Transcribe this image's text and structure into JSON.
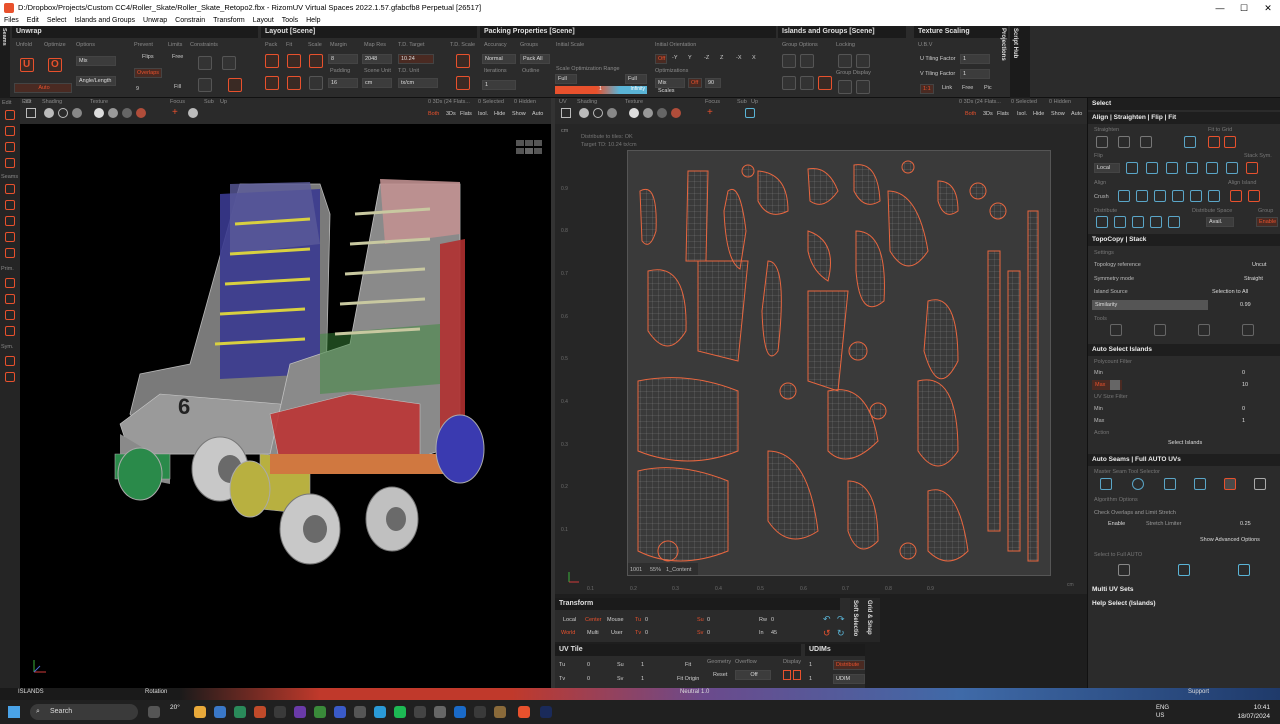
{
  "window": {
    "title": "D:/Dropbox/Projects/Custom CC4/Roller_Skate/Roller_Skate_Retopo2.fbx - RizomUV  Virtual Spaces 2022.1.57.gfabcfb8 Perpetual  [26517]",
    "minimize": "—",
    "maximize": "☐",
    "close": "✕"
  },
  "menu": [
    "Files",
    "Edit",
    "Select",
    "Islands and Groups",
    "Unwrap",
    "Constrain",
    "Transform",
    "Layout",
    "Tools",
    "Help"
  ],
  "ribbon": {
    "seams_tab": "Seams",
    "unwrap": {
      "title": "Unwrap",
      "labels": [
        "Unfold",
        "Optimize",
        "Options",
        "Prevent",
        "Limits",
        "Constraints"
      ],
      "auto": "Auto",
      "mix": "Mix",
      "angle_length": "Angle/Length",
      "flips": "Flips",
      "overlaps": "Overlaps",
      "free": "Free",
      "fill": "Fill",
      "value_9": "9"
    },
    "layout": {
      "title": "Layout [Scene]",
      "labels": [
        "Pack",
        "Fit",
        "Scale",
        "Margin",
        "Map Res",
        "T.D. Target",
        "T.D. Scale",
        "Padding",
        "Scene Unit",
        "T.D. Unit"
      ],
      "margin": "8",
      "map_res": "2048",
      "td_target": "10.24",
      "padding": "16",
      "scene_unit": "cm",
      "td_unit": "tx/cm"
    },
    "packing": {
      "title": "Packing Properties [Scene]",
      "labels": [
        "Accuracy",
        "Groups",
        "Initial Scale",
        "Initial Orientation",
        "Iterations",
        "Outline",
        "Scale Optimization Range",
        "Optimizations"
      ],
      "accuracy": "Normal",
      "pack_all": "Pack All",
      "iterations": "1",
      "full1": "Full",
      "full2": "Full",
      "mix_scales": "Mix Scales",
      "off1": "Off",
      "off2": "Off",
      "value_90": "90",
      "infinity": "Infinity",
      "one": "1",
      "axes": [
        "-Y",
        "Y",
        "-Z",
        "Z",
        "-X",
        "X"
      ]
    },
    "islands": {
      "title": "Islands and Groups [Scene]",
      "labels": [
        "Group Options",
        "Locking",
        "Group Display"
      ]
    },
    "texture": {
      "title": "Texture Scaling",
      "uvs": "U.B.V",
      "u_tiling": "U Tiling Factor",
      "u_val": "1",
      "v_tiling": "V Tiling Factor",
      "v_val": "1",
      "ratio": "1:1",
      "link": "Link",
      "free": "Free",
      "pic": "Pic"
    },
    "script_hub": "Script Hub",
    "projections": "Projections"
  },
  "vp3d": {
    "labels": [
      "Edit",
      "3D",
      "Shading",
      "Texture",
      "Focus",
      "Sub",
      "Up"
    ],
    "counts": "0 3Ds (24 Flats...",
    "selected": "0 Selected",
    "hidden": "0 Hidden",
    "modes": [
      "Both",
      "3Ds",
      "Flats",
      "Isol.",
      "Hide",
      "Show",
      "Auto"
    ],
    "left_labels": [
      "Edit",
      "Seams",
      "Prim.",
      "Sym."
    ]
  },
  "uv": {
    "labels": [
      "UV",
      "Shading",
      "Texture",
      "Focus",
      "Sub",
      "Up"
    ],
    "counts": "0 3Ds (24 Flats...",
    "selected": "0 Selected",
    "hidden": "0 Hidden",
    "modes": [
      "Both",
      "3Ds",
      "Flats",
      "Isol.",
      "Hide",
      "Show",
      "Auto"
    ],
    "info_line1": "Distribute to tiles: OK",
    "info_line2": "Target TD: 10.24 tx/cm",
    "udim_tile": "1001",
    "udim_pct": "55%",
    "udim_name": "1_Content",
    "ticks_x": [
      "0.1",
      "0.2",
      "0.3",
      "0.4",
      "0.5",
      "0.6",
      "0.7",
      "0.8",
      "0.9"
    ],
    "ticks_y": [
      "0.9",
      "0.8",
      "0.7",
      "0.6",
      "0.5",
      "0.4",
      "0.3",
      "0.2",
      "0.1"
    ],
    "unit_corner": "cm",
    "unit_y": "cm"
  },
  "transform": {
    "title": "Transform",
    "local": "Local",
    "center": "Center",
    "mouse": "Mouse",
    "world": "World",
    "multi": "Multi",
    "user": "User",
    "tu": "Tu",
    "tu_val": "0",
    "tv": "Tv",
    "tv_val": "0",
    "su": "Su",
    "su_val": "0",
    "sv": "Sv",
    "sv_val": "0",
    "rw": "Rw",
    "rw_val": "0",
    "in": "In",
    "in_val": "45"
  },
  "uvtile": {
    "title": "UV Tile",
    "tu": "Tu",
    "tu_val": "0",
    "su": "Su",
    "su_val": "1",
    "tv": "Tv",
    "tv_val": "0",
    "sv": "Sv",
    "sv_val": "1",
    "fit": "Fit",
    "fit_origin": "Fit Origin",
    "geometry": "Geometry",
    "overflow": "Overflow",
    "reset": "Reset",
    "off": "Off",
    "display": "Display"
  },
  "udims": {
    "title": "UDIMs",
    "distribute": "Distribute",
    "val": "1",
    "udim": "UDIM"
  },
  "sidepanels": {
    "grid_snap": "Grid & Snap",
    "soft_selection": "Soft Selectio"
  },
  "right": {
    "select": "Select",
    "align": "Align | Straighten | Flip | Fit",
    "align_labels": [
      "Straighten",
      "Fit to Grid",
      "Flip",
      "Stack Sym.",
      "Local",
      "Align",
      "Align Island",
      "Crush",
      "Distribute",
      "Distribute Space",
      "Avail.",
      "Group",
      "Enable"
    ],
    "topo": {
      "title": "TopoCopy | Stack",
      "settings": "Settings",
      "topology_reference": "Topology reference",
      "topology_val": "Uncut",
      "symmetry_mode": "Symmetry mode",
      "symmetry_val": "Straight",
      "island_source": "Island Source",
      "island_val": "Selection to All",
      "similarity": "Similarity",
      "similarity_val": "0.99",
      "tools": "Tools"
    },
    "auto_select": {
      "title": "Auto Select Islands",
      "polycount": "Polycount Filter",
      "min": "Min",
      "min_val": "0",
      "max": "Max",
      "max_val": "10",
      "uv_size": "UV Size Filter",
      "min2": "Min",
      "min2_val": "0",
      "max2": "Max",
      "max2_val": "1",
      "action": "Action",
      "select_islands": "Select Islands"
    },
    "auto_seams": {
      "title": "Auto Seams | Full AUTO UVs",
      "master": "Master Seam Tool Selector",
      "algo": "Algorithm Options",
      "check": "Check Overlaps and Limit Stretch",
      "enable": "Enable",
      "stretch_limiter": "Stretch Limiter",
      "stretch_val": "0.25",
      "show_adv": "Show Advanced Options",
      "select_full": "Select to Full AUTO"
    },
    "multi_uv": "Multi UV Sets",
    "help_select": "Help Select (Islands)"
  },
  "status": {
    "islands": "ISLANDS",
    "rotation": "Rotation",
    "support": "Support",
    "neutral": "Neutral 1.0"
  },
  "taskbar": {
    "search": "Search",
    "weather": "20°",
    "lang1": "ENG",
    "lang2": "US",
    "time": "10:41",
    "date": "18/07/2024"
  },
  "colors": {
    "accent": "#e8512d",
    "cyan": "#5ab4d6",
    "uv_bg": "#3a3a3a"
  }
}
